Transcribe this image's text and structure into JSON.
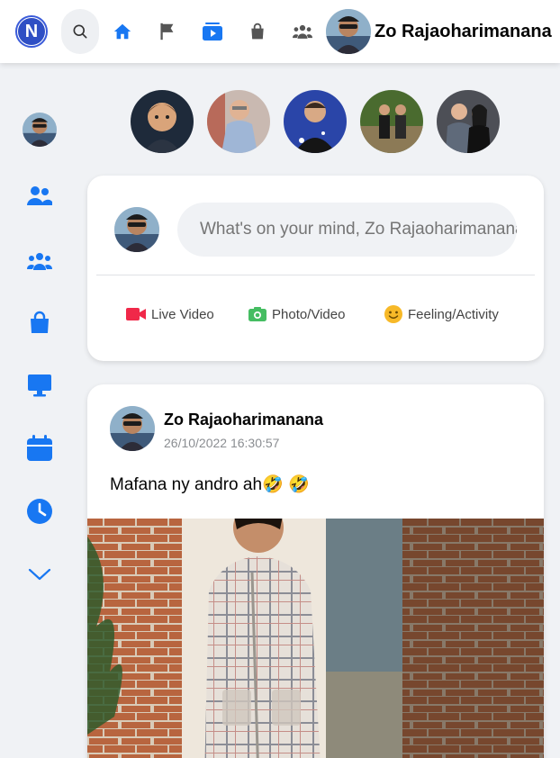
{
  "brand": {
    "logo_letter": "N"
  },
  "topbar": {
    "nav_icons": [
      "search-icon",
      "home-icon",
      "flag-icon",
      "video-icon",
      "marketplace-icon",
      "groups-icon"
    ],
    "profile_name": "Zo Rajaoharimanana",
    "accent": "#1877f2"
  },
  "sidebar": {
    "items": [
      "profile-avatar",
      "friends-icon",
      "groups-icon",
      "marketplace-icon",
      "watch-icon",
      "events-icon",
      "memories-icon",
      "chevron-down-icon"
    ]
  },
  "stories": {
    "count": 5
  },
  "composer": {
    "placeholder": "What's on your mind, Zo Rajaoharimanana?",
    "actions": [
      {
        "label": "Live Video",
        "icon": "live-video-icon",
        "color": "#f02849"
      },
      {
        "label": "Photo/Video",
        "icon": "photo-icon",
        "color": "#45bd62"
      },
      {
        "label": "Feeling/Activity",
        "icon": "feeling-icon",
        "color": "#f7b928"
      }
    ]
  },
  "post": {
    "author": "Zo Rajaoharimanana",
    "timestamp": "26/10/2022 16:30:57",
    "text": "Mafana ny andro ah🤣 🤣"
  }
}
